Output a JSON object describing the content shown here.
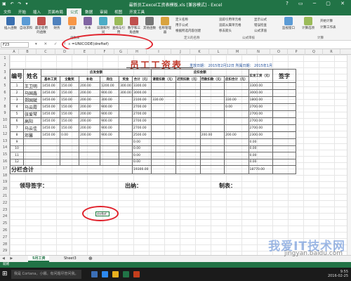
{
  "window": {
    "title": "最新员工excel工资表模板.xls [兼容模式] - Excel",
    "qat": "▣ ↶ ↷ ▾",
    "controls": "? ▭ ─ ▢ ✕"
  },
  "tabs": [
    "文件",
    "开始",
    "插入",
    "页面布局",
    "公式",
    "数据",
    "审阅",
    "视图",
    "开发工具"
  ],
  "active_tab_index": 4,
  "ribbon": {
    "buttons": [
      {
        "label": "插入函数",
        "color": "#3a6fb0"
      },
      {
        "label": "自动求和",
        "color": "#5b9bd5"
      },
      {
        "label": "最近使用的函数",
        "color": "#c0504d"
      },
      {
        "label": "财务",
        "color": "#4f81bd"
      },
      {
        "label": "逻辑",
        "color": "#f79646"
      },
      {
        "label": "文本",
        "color": "#8064a2"
      },
      {
        "label": "日期和时间",
        "color": "#4bacc6"
      },
      {
        "label": "查找与引用",
        "color": "#9bbb59"
      },
      {
        "label": "数学和三角函数",
        "color": "#c0504d"
      },
      {
        "label": "其他函数",
        "color": "#777777"
      },
      {
        "label": "名称管理器",
        "color": "#d9a33e"
      }
    ],
    "name_items": [
      "定义名称",
      "用于公式",
      "根据所选内容创建"
    ],
    "audit_items": [
      "追踪引用单元格",
      "追踪从属单元格",
      "移去箭头"
    ],
    "audit_items2": [
      "显示公式",
      "错误检查",
      "公式求值"
    ],
    "watch": "监视窗口",
    "calc": "计算选项",
    "calc_items": [
      "开始计算",
      "计算工作表"
    ],
    "groups": [
      "函数库",
      "定义的名称",
      "公式审核",
      "计算"
    ]
  },
  "formula_bar": {
    "name_box": "F23",
    "icons": "▾ ✕ ✓ fx",
    "formula": "=UNICODE(dreftef)"
  },
  "columns": [
    "A",
    "B",
    "C",
    "D",
    "E",
    "F",
    "G",
    "H",
    "I",
    "J",
    "K",
    "L",
    "M",
    "N",
    "O",
    "P",
    "Q",
    "R"
  ],
  "rows": [
    "1",
    "2",
    "3",
    "4",
    "5",
    "6",
    "7",
    "8",
    "9",
    "10",
    "11",
    "12",
    "13",
    "14",
    "15",
    "16",
    "17",
    "18",
    "19",
    "20",
    "21",
    "22",
    "23",
    "24",
    "25",
    "26",
    "27",
    "28",
    "29"
  ],
  "sheet": {
    "title": "员工工资表",
    "date_line": "发放日期： 2015年2月12日 所属日期： 2015年1月",
    "headers": {
      "no": "编号",
      "name": "姓名",
      "payable": "应发金额",
      "deduct": "应扣金额",
      "actual": "实发工资（元）",
      "signature": "签字"
    },
    "sub_headers": [
      "基本工资",
      "全勤奖",
      "补助",
      "岗位",
      "奖金",
      "合计（元）",
      "请假扣款（元）",
      "迟到扣款（元）",
      "罚款扣款（元）",
      "应扣合计（元）"
    ],
    "rows": [
      {
        "no": "1",
        "name": "王卫明",
        "base": "1450.00",
        "full": "150.00",
        "sub": "200.00",
        "post": "1200.00",
        "bonus": "300.00",
        "total": "3300.00",
        "leave": "",
        "late": "",
        "fine": "",
        "dsum": "",
        "net": "3300.00"
      },
      {
        "no": "2",
        "name": "马国鑫",
        "base": "1450.00",
        "full": "150.00",
        "sub": "200.00",
        "post": "900.00",
        "bonus": "300.00",
        "total": "3000.00",
        "leave": "",
        "late": "",
        "fine": "",
        "dsum": "",
        "net": "3000.00"
      },
      {
        "no": "3",
        "name": "郑国斌",
        "base": "1450.00",
        "full": "150.00",
        "sub": "200.00",
        "post": "300.00",
        "bonus": "",
        "total": "2100.00",
        "leave": "330.00",
        "late": "",
        "fine": "",
        "dsum": "330.00",
        "net": "1800.00"
      },
      {
        "no": "4",
        "name": "马云霞",
        "base": "1450.00",
        "full": "150.00",
        "sub": "200.00",
        "post": "900.00",
        "bonus": "",
        "total": "2700.00",
        "leave": "",
        "late": "",
        "fine": "",
        "dsum": "0.00",
        "net": "2700.00"
      },
      {
        "no": "5",
        "name": "张爱琴",
        "base": "1450.00",
        "full": "150.00",
        "sub": "200.00",
        "post": "900.00",
        "bonus": "",
        "total": "2700.00",
        "leave": "",
        "late": "",
        "fine": "",
        "dsum": "",
        "net": "2700.00"
      },
      {
        "no": "6",
        "name": "高阳",
        "base": "1450.00",
        "full": "150.00",
        "sub": "200.00",
        "post": "900.00",
        "bonus": "",
        "total": "2700.00",
        "leave": "",
        "late": "",
        "fine": "",
        "dsum": "",
        "net": "2700.00"
      },
      {
        "no": "7",
        "name": "马云佳",
        "base": "1450.00",
        "full": "150.00",
        "sub": "200.00",
        "post": "900.00",
        "bonus": "",
        "total": "2700.00",
        "leave": "",
        "late": "",
        "fine": "",
        "dsum": "",
        "net": "2700.00"
      },
      {
        "no": "8",
        "name": "邓馨",
        "base": "1450.00",
        "full": "0.00",
        "sub": "200.00",
        "post": "900.00",
        "bonus": "",
        "total": "2500.00",
        "leave": "",
        "late": "",
        "fine": "200.00",
        "dsum": "200.00",
        "net": "2300.00"
      },
      {
        "no": "9",
        "name": "",
        "base": "",
        "full": "",
        "sub": "",
        "post": "",
        "bonus": "",
        "total": "0.00",
        "leave": "",
        "late": "",
        "fine": "",
        "dsum": "",
        "net": "0.00"
      },
      {
        "no": "10",
        "name": "",
        "base": "",
        "full": "",
        "sub": "",
        "post": "",
        "bonus": "",
        "total": "0.00",
        "leave": "",
        "late": "",
        "fine": "",
        "dsum": "",
        "net": "0.00"
      },
      {
        "no": "11",
        "name": "",
        "base": "",
        "full": "",
        "sub": "",
        "post": "",
        "bonus": "",
        "total": "0.00",
        "leave": "",
        "late": "",
        "fine": "",
        "dsum": "",
        "net": "0.00"
      },
      {
        "no": "12",
        "name": "",
        "base": "",
        "full": "",
        "sub": "",
        "post": "",
        "bonus": "",
        "total": "0.00",
        "leave": "",
        "late": "",
        "fine": "",
        "dsum": "",
        "net": "0.00"
      }
    ],
    "subtotal_label": "分栏合计",
    "subtotal_total": "19300.00",
    "subtotal_net": "18770.00",
    "sig_leader": "领导签字：",
    "sig_cashier": "出纳：",
    "sig_maker": "制表：",
    "active_cell_text": "dreftef"
  },
  "sheet_tabs": [
    "5月工资",
    "Sheet3"
  ],
  "sheet_nav": "◀ ▶",
  "status": "就绪",
  "taskbar": {
    "start": "⊞",
    "search": "我是 Cortana，小娜。有问题尽管问我。",
    "time": "9:55",
    "date": "2016-02-25"
  },
  "watermark": {
    "main": "我爱IT技术网",
    "sub": "jingyan.baidu.com"
  },
  "colors": {
    "excel_green": "#217346",
    "annotation_red": "#e0202a",
    "title_red": "#c0392b"
  }
}
